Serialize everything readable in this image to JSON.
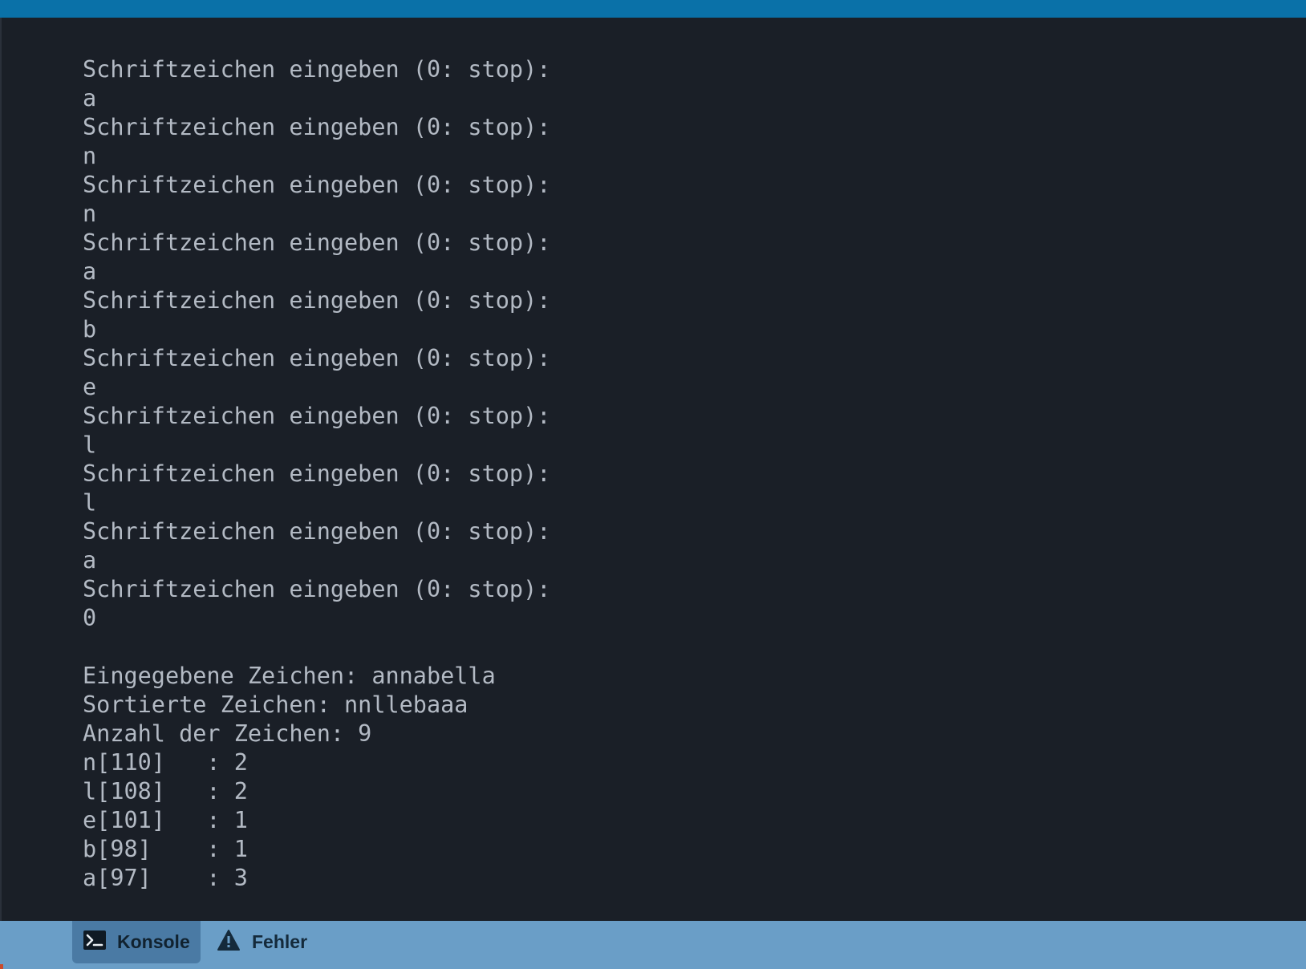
{
  "console": {
    "lines": [
      "Schriftzeichen eingeben (0: stop):",
      "a",
      "Schriftzeichen eingeben (0: stop):",
      "n",
      "Schriftzeichen eingeben (0: stop):",
      "n",
      "Schriftzeichen eingeben (0: stop):",
      "a",
      "Schriftzeichen eingeben (0: stop):",
      "b",
      "Schriftzeichen eingeben (0: stop):",
      "e",
      "Schriftzeichen eingeben (0: stop):",
      "l",
      "Schriftzeichen eingeben (0: stop):",
      "l",
      "Schriftzeichen eingeben (0: stop):",
      "a",
      "Schriftzeichen eingeben (0: stop):",
      "0",
      "",
      "Eingegebene Zeichen: annabella",
      "Sortierte Zeichen: nnllebaaa",
      "Anzahl der Zeichen: 9",
      "n[110]   : 2",
      "l[108]   : 2",
      "e[101]   : 1",
      "b[98]    : 1",
      "a[97]    : 3"
    ]
  },
  "bottom_tabs": {
    "konsole": {
      "label": "Konsole",
      "icon": "terminal-icon",
      "active": true
    },
    "fehler": {
      "label": "Fehler",
      "icon": "warning-icon",
      "active": false
    }
  },
  "colors": {
    "top_bar": "#0a71a8",
    "console_bg": "#1a1f27",
    "console_text": "#b3bac4",
    "bottom_bar": "#6a9ec7",
    "active_tab": "#4a7aa4"
  }
}
